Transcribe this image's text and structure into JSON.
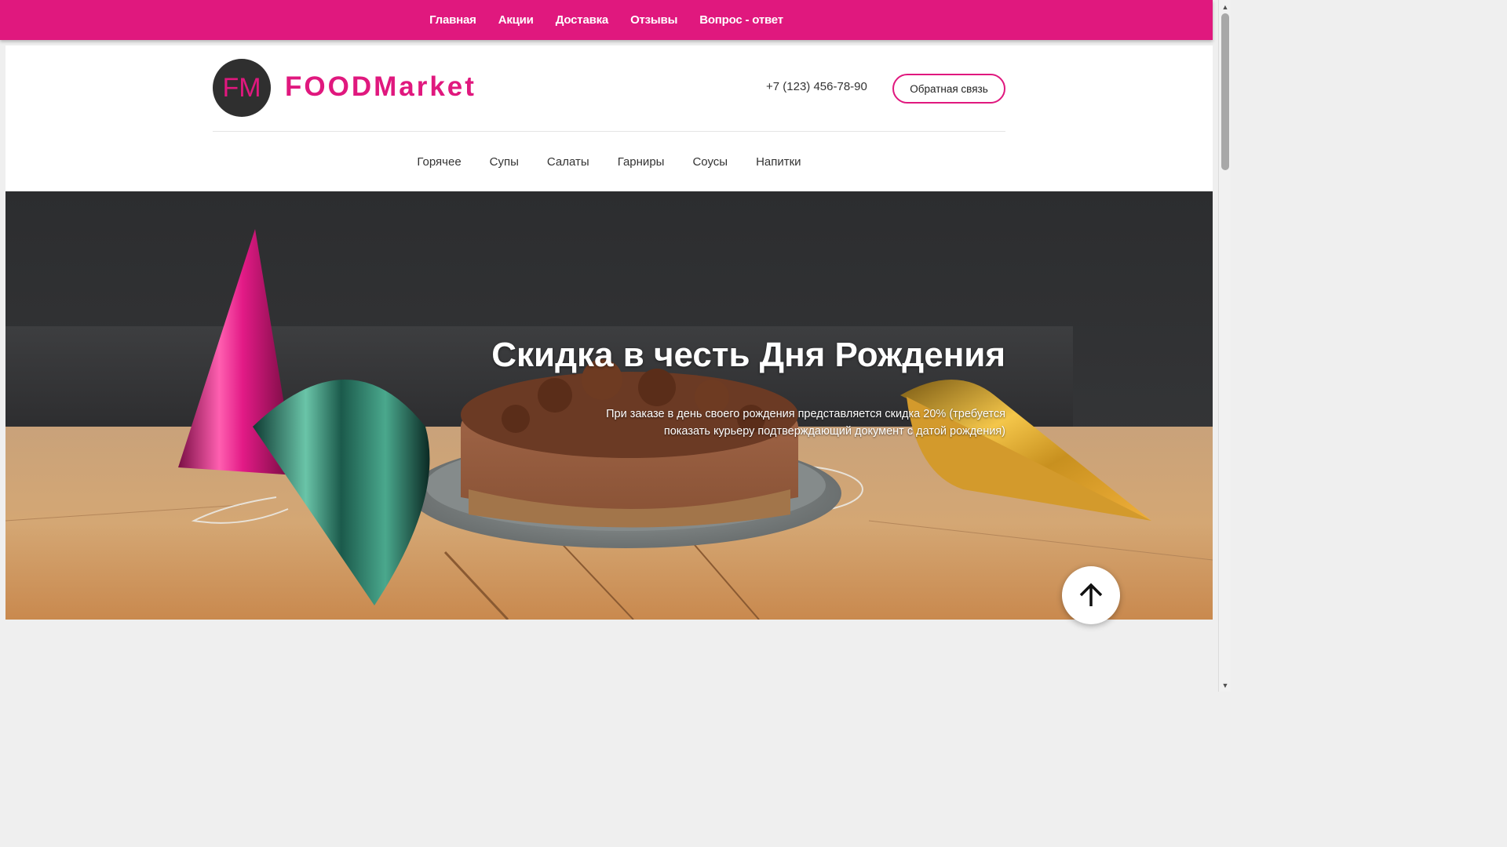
{
  "topnav": {
    "items": [
      "Главная",
      "Акции",
      "Доставка",
      "Отзывы",
      "Вопрос - ответ"
    ],
    "bg_color": "#e0187e"
  },
  "header": {
    "logo_initials": "FM",
    "brand_name": "FOODMarket",
    "phone": "+7 (123) 456-78-90",
    "feedback_label": "Обратная связь",
    "accent_color": "#e0187e"
  },
  "categories": [
    "Горячее",
    "Супы",
    "Салаты",
    "Гарниры",
    "Соусы",
    "Напитки"
  ],
  "hero": {
    "title": "Скидка в честь Дня Рождения",
    "text": "При заказе в день своего рождения представляется скидка 20% (требуется показать курьеру подтверждающий документ с датой рождения)"
  },
  "icons": {
    "to_top": "arrow-up-icon",
    "scroll_up": "triangle-up-icon",
    "scroll_down": "triangle-down-icon"
  }
}
